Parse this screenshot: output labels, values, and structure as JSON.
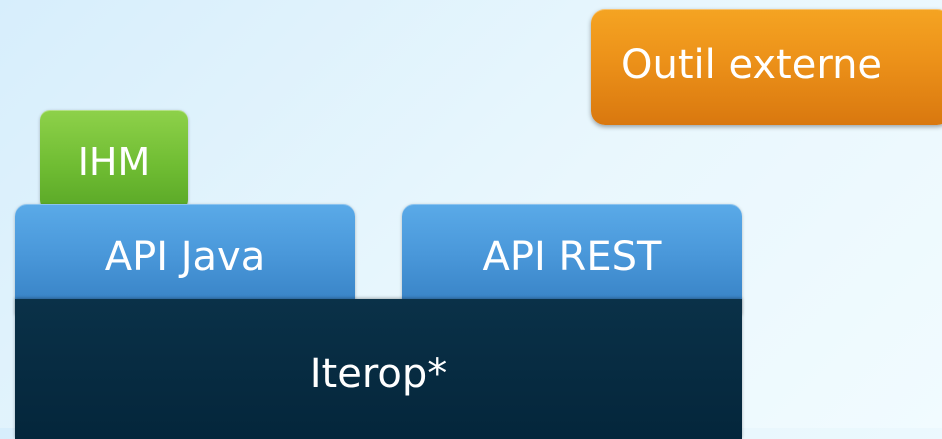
{
  "diagram": {
    "outil_externe": {
      "label": "Outil externe",
      "color": "#ec9119"
    },
    "ihm": {
      "label": "IHM",
      "color": "#70bd33"
    },
    "api_java": {
      "label": "API Java",
      "color": "#4a98da"
    },
    "api_rest": {
      "label": "API REST",
      "color": "#4a98da"
    },
    "iterop": {
      "label": "Iterop*",
      "color": "#04263b"
    }
  }
}
